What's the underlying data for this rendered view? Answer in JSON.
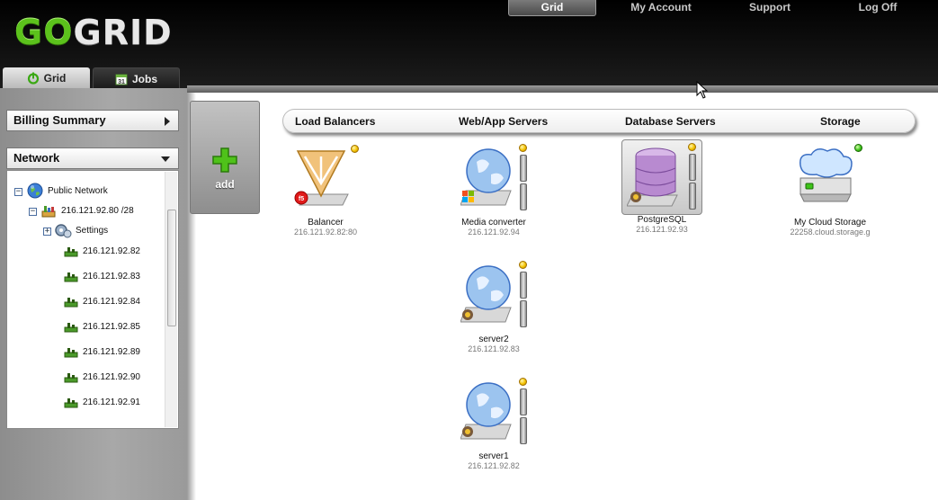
{
  "logo": {
    "text_part1": "GO",
    "text_part2": "GRID"
  },
  "topnav": [
    {
      "label": "Grid",
      "active": true
    },
    {
      "label": "My Account",
      "active": false
    },
    {
      "label": "Support",
      "active": false
    },
    {
      "label": "Log Off",
      "active": false
    }
  ],
  "tabs": [
    {
      "label": "Grid",
      "icon": "power-icon",
      "active": true
    },
    {
      "label": "Jobs",
      "icon": "calendar-icon",
      "active": false
    }
  ],
  "sidebar": {
    "billing_summary": "Billing Summary",
    "network": "Network",
    "tree": {
      "public_network": "Public Network",
      "subnet": "216.121.92.80 /28",
      "settings": "Settings",
      "ips": [
        "216.121.92.82",
        "216.121.92.83",
        "216.121.92.84",
        "216.121.92.85",
        "216.121.92.89",
        "216.121.92.90",
        "216.121.92.91"
      ]
    }
  },
  "add_button": {
    "label": "add"
  },
  "categories": [
    "Load Balancers",
    "Web/App Servers",
    "Database Servers",
    "Storage"
  ],
  "servers": [
    {
      "name": "Balancer",
      "ip": "216.121.92.82:80",
      "type": "load-balancer",
      "status": "amber",
      "os": "f5"
    },
    {
      "name": "Media converter",
      "ip": "216.121.92.94",
      "type": "web-server",
      "status": "amber",
      "os": "windows"
    },
    {
      "name": "PostgreSQL",
      "ip": "216.121.92.93",
      "type": "database",
      "status": "amber",
      "os": "linux",
      "selected": true
    },
    {
      "name": "My Cloud Storage",
      "ip": "22258.cloud.storage.g",
      "type": "storage",
      "status": "green"
    },
    {
      "name": "server2",
      "ip": "216.121.92.83",
      "type": "web-server",
      "status": "amber",
      "os": "linux"
    },
    {
      "name": "server1",
      "ip": "216.121.92.82",
      "type": "web-server",
      "status": "amber",
      "os": "linux"
    }
  ],
  "colors": {
    "brand_green": "#5cc21c",
    "status_amber": "#f4c300",
    "status_green": "#3ec41a",
    "header_bg": "#000000"
  }
}
